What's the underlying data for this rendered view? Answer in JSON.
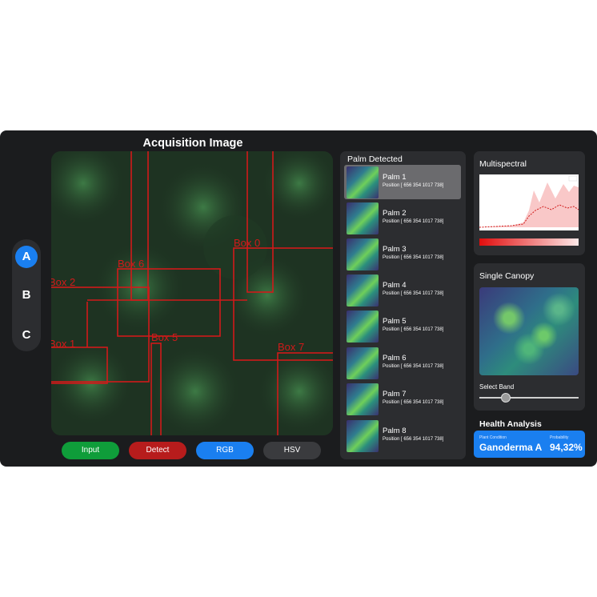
{
  "header": {
    "title": "Acquisition Image"
  },
  "mode_selector": {
    "items": [
      "A",
      "B",
      "C"
    ],
    "active": "A"
  },
  "image": {
    "boxes": [
      "Box 0",
      "Box 6",
      "Box 2",
      "Box 5",
      "Box 1",
      "Box 7"
    ],
    "box_color": "#d11a1a"
  },
  "buttons": {
    "input": "Input",
    "detect": "Detect",
    "rgb": "RGB",
    "hsv": "HSV"
  },
  "colors": {
    "input": "#0f9d3a",
    "detect": "#b71c1c",
    "rgb": "#1a7ff0",
    "hsv": "#3a3b3e",
    "accent": "#1a7ff0"
  },
  "palm_panel": {
    "title": "Palm Detected",
    "items": [
      {
        "name": "Palm 1",
        "position": "Position [ 656  354 1017  738]"
      },
      {
        "name": "Palm 2",
        "position": "Position [ 656  354 1017  738]"
      },
      {
        "name": "Palm 3",
        "position": "Position [ 656  354 1017  738]"
      },
      {
        "name": "Palm 4",
        "position": "Position [ 656  354 1017  738]"
      },
      {
        "name": "Palm 5",
        "position": "Position [ 656  354 1017  738]"
      },
      {
        "name": "Palm 6",
        "position": "Position [ 656  354 1017  738]"
      },
      {
        "name": "Palm 7",
        "position": "Position [ 656  354 1017  738]"
      },
      {
        "name": "Palm 8",
        "position": "Position [ 656  354 1017  738]"
      }
    ],
    "selected": 0
  },
  "multispectral": {
    "title": "Multispectral"
  },
  "single_canopy": {
    "title": "Single Canopy",
    "slider_label": "Select Band"
  },
  "health": {
    "title": "Health Analysis",
    "condition_label": "Plant Condition",
    "condition_value": "Ganoderma A",
    "probability_label": "Probability",
    "probability_value": "94,32%"
  }
}
